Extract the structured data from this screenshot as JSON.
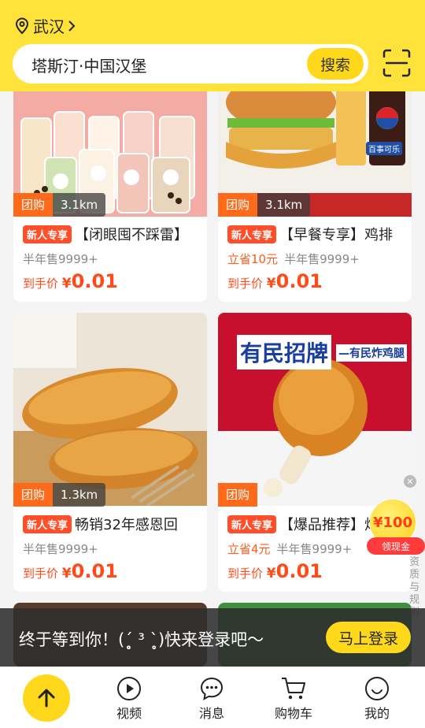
{
  "header": {
    "location": "武汉",
    "search_text": "塔斯汀·中国汉堡",
    "search_button": "搜索"
  },
  "cards": [
    {
      "tag": "团购",
      "distance": "3.1km",
      "badge": "新人专享",
      "title": "【闭眼囤不踩雷】",
      "save": "",
      "sales": "半年售9999+",
      "price_label": "到手价",
      "currency": "¥",
      "price": "0.01"
    },
    {
      "tag": "团购",
      "distance": "3.1km",
      "badge": "新人专享",
      "title": "【早餐专享】鸡排",
      "save": "立省10元",
      "sales": "半年售9999+",
      "price_label": "到手价",
      "currency": "¥",
      "price": "0.01"
    },
    {
      "tag": "团购",
      "distance": "1.3km",
      "badge": "新人专享",
      "title": "畅销32年感恩回",
      "save": "",
      "sales": "半年售9999+",
      "price_label": "到手价",
      "currency": "¥",
      "price": "0.01"
    },
    {
      "tag": "团购",
      "distance": "",
      "badge": "新人专享",
      "title": "【爆品推荐】炸",
      "save": "立省4元",
      "sales": "半年售9999+",
      "price_label": "到手价",
      "currency": "¥",
      "price": "0.01"
    }
  ],
  "image_text": {
    "pepsi": "百事可乐",
    "poster_main": "有民招牌",
    "poster_sub": "—有民炸鸡腿"
  },
  "coupon": {
    "amount": "¥100",
    "label": "领现金",
    "side_text": "资质与规则"
  },
  "login_banner": {
    "text": "终于等到你！(ˊ̥̥̥̥̥ ³ ˋ̥̥̥̥̥)快来登录吧～",
    "button": "马上登录"
  },
  "nav": {
    "items": [
      "视频",
      "消息",
      "购物车",
      "我的"
    ]
  },
  "colors": {
    "brand_yellow": "#ffe23a",
    "accent_orange": "#ff6a1a",
    "price_red": "#ff4a1a"
  }
}
